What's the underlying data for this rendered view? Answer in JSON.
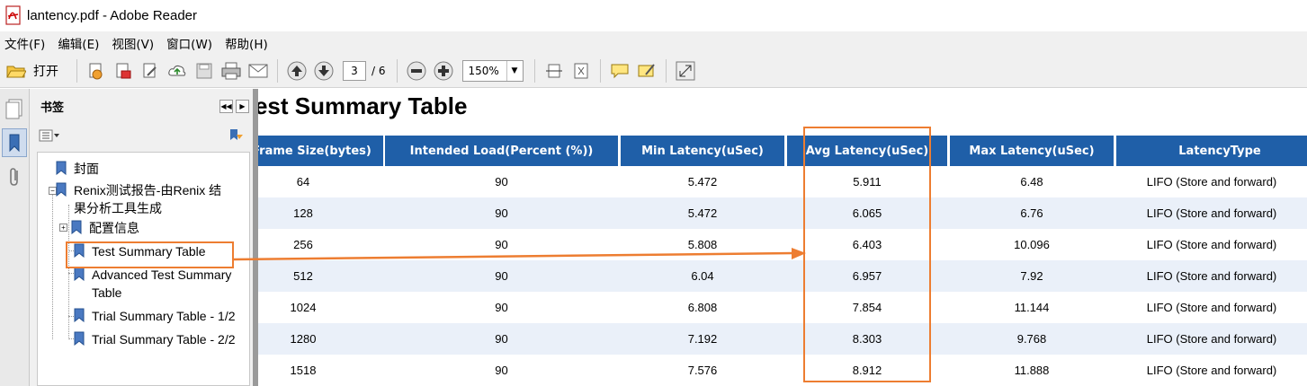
{
  "window": {
    "title": "lantency.pdf - Adobe Reader"
  },
  "menu": [
    "文件(F)",
    "编辑(E)",
    "视图(V)",
    "窗口(W)",
    "帮助(H)"
  ],
  "toolbar": {
    "open_label": "打开",
    "page_current": "3",
    "page_total": "/ 6",
    "zoom": "150%"
  },
  "bookmarks": {
    "title": "书签",
    "items": [
      "封面",
      "Renix测试报告-由Renix 结",
      "果分析工具生成",
      "配置信息",
      "Test Summary Table",
      "Advanced Test Summary",
      "Table",
      "Trial Summary Table - 1/2",
      "Trial Summary Table - 2/2"
    ]
  },
  "document": {
    "heading": "Test Summary Table",
    "columns": [
      "Frame Size(bytes)",
      "Intended Load(Percent (%))",
      "Min Latency(uSec)",
      "Avg Latency(uSec)",
      "Max Latency(uSec)",
      "LatencyType"
    ],
    "rows": [
      [
        "64",
        "90",
        "5.472",
        "5.911",
        "6.48",
        "LIFO (Store and forward)"
      ],
      [
        "128",
        "90",
        "5.472",
        "6.065",
        "6.76",
        "LIFO (Store and forward)"
      ],
      [
        "256",
        "90",
        "5.808",
        "6.403",
        "10.096",
        "LIFO (Store and forward)"
      ],
      [
        "512",
        "90",
        "6.04",
        "6.957",
        "7.92",
        "LIFO (Store and forward)"
      ],
      [
        "1024",
        "90",
        "6.808",
        "7.854",
        "11.144",
        "LIFO (Store and forward)"
      ],
      [
        "1280",
        "90",
        "7.192",
        "8.303",
        "9.768",
        "LIFO (Store and forward)"
      ],
      [
        "1518",
        "90",
        "7.576",
        "8.912",
        "11.888",
        "LIFO (Store and forward)"
      ]
    ]
  },
  "colors": {
    "header_bg": "#1f5fa8",
    "alt_row": "#eaf0f9",
    "annotation": "#ed7d31"
  },
  "icons": [
    "pdf-icon",
    "open-folder-icon",
    "pages-icon",
    "bookmark-icon",
    "attachment-icon"
  ]
}
